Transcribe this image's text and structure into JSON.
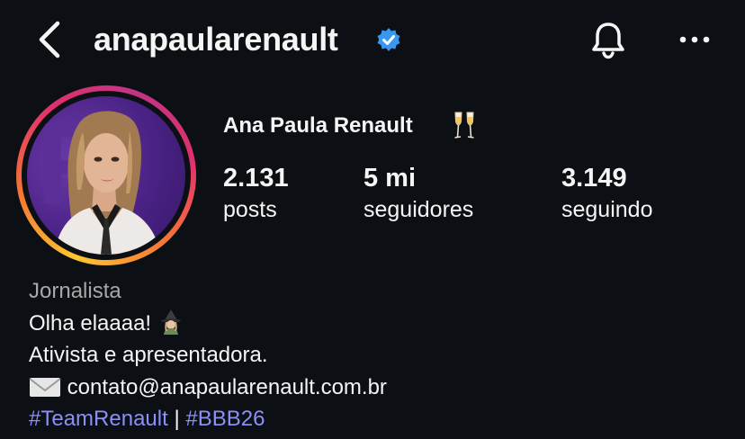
{
  "header": {
    "username": "anapaularenault"
  },
  "profile": {
    "full_name": "Ana Paula Renault",
    "stats": [
      {
        "value": "2.131",
        "label": "posts"
      },
      {
        "value": "5 mi",
        "label": "seguidores"
      },
      {
        "value": "3.149",
        "label": "seguindo"
      }
    ]
  },
  "bio": {
    "category": "Jornalista",
    "line1": "Olha elaaaa!",
    "line2": "Ativista e apresentadora.",
    "email": "contato@anapaularenault.com.br",
    "hashtag1": "#TeamRenault",
    "separator": "|",
    "hashtag2": "#BBB26"
  },
  "colors": {
    "background": "#0c1014",
    "text": "#f5f5f5",
    "muted": "#a8a8a8",
    "hashtag": "#8c8ff5",
    "verified": "#3897f0"
  },
  "icons": [
    "back-arrow-icon",
    "verified-badge-icon",
    "bell-icon",
    "more-options-icon",
    "champagne-emoji-icon",
    "witch-emoji-icon",
    "envelope-emoji-icon"
  ]
}
